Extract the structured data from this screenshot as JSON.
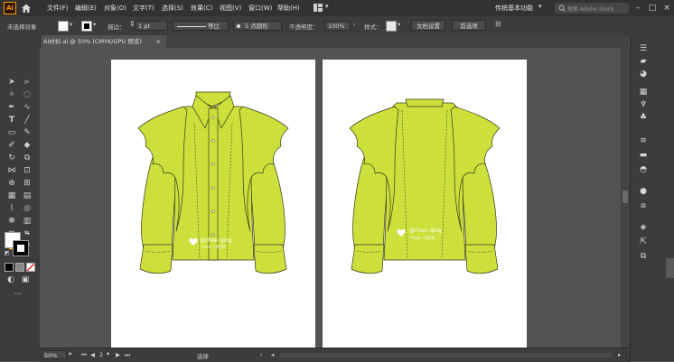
{
  "menus": [
    "文件(F)",
    "编辑(E)",
    "对象(O)",
    "文字(T)",
    "选择(S)",
    "效果(C)",
    "视图(V)",
    "窗口(W)",
    "帮助(H)"
  ],
  "workspace": "传统基本功能",
  "search_placeholder": "搜索 Adobe Stock",
  "control": {
    "selection_label": "未选择对象",
    "stroke_label": "描边：",
    "stroke_width": "1 pt",
    "stroke_style": "等比",
    "brush_label": "5 点圆形",
    "opacity_label": "不透明度：",
    "opacity_value": "100%",
    "style_label": "样式：",
    "doc_setup": "文档设置",
    "preferences": "首选项"
  },
  "document_tab": "AI衬衫.ai @ 50% (CMYK/GPU 预览)",
  "status": {
    "zoom": "50%",
    "artboard_num": "2",
    "tool_name": "选择"
  },
  "watermark": {
    "handle": "@chen qing",
    "source": "From 小红书"
  },
  "colors": {
    "shirt_fill": "#ccdf3a",
    "shirt_stroke": "#3a3a1a",
    "canvas": "#535353",
    "panel": "#3c3c3c",
    "menubar": "#323232"
  }
}
